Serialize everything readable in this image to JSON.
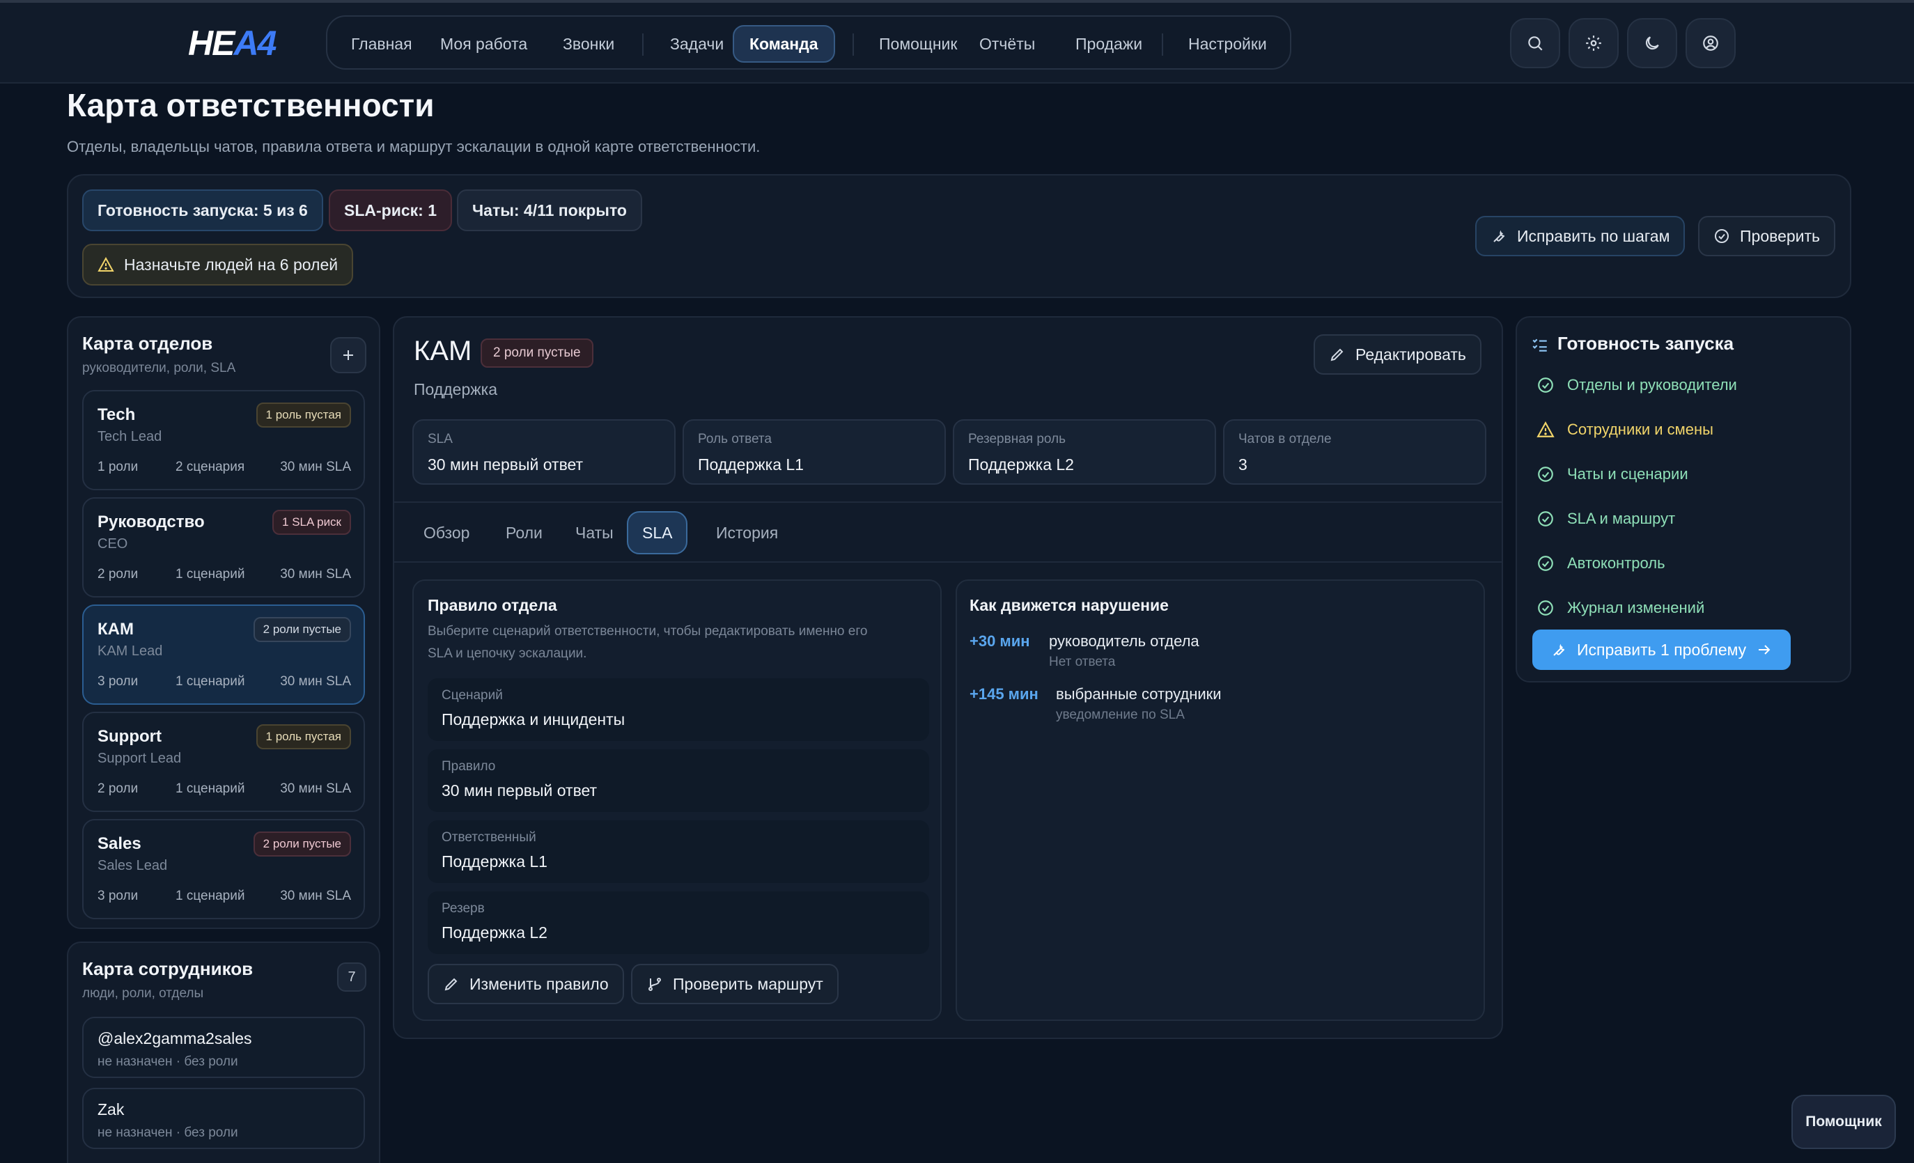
{
  "app": {
    "logo_white": "НЕ",
    "logo_blue": "А4"
  },
  "nav": {
    "items": [
      "Главная",
      "Моя работа",
      "Звонки",
      "Задачи",
      "Команда",
      "Помощник",
      "Отчёты",
      "Продажи",
      "Настройки"
    ],
    "active": "Команда"
  },
  "page": {
    "title": "Карта ответственности",
    "subtitle": "Отделы, владельцы чатов, правила ответа и маршрут эскалации в одной карте ответственности."
  },
  "status": {
    "pills": [
      "Готовность запуска: 5 из 6",
      "SLA-риск: 1",
      "Чаты: 4/11 покрыто"
    ],
    "warning": "Назначьте людей на 6 ролей",
    "fix_label": "Исправить по шагам",
    "check_label": "Проверить"
  },
  "departments": {
    "title": "Карта отделов",
    "subtitle": "руководители, роли, SLA",
    "items": [
      {
        "name": "Tech",
        "lead": "Tech Lead",
        "badge": "1 роль пустая",
        "roles": "1 роли",
        "scenarios": "2 сценария",
        "sla": "30 мин SLA"
      },
      {
        "name": "Руководство",
        "lead": "CEO",
        "badge": "1 SLA риск",
        "roles": "2 роли",
        "scenarios": "1 сценарий",
        "sla": "30 мин SLA"
      },
      {
        "name": "КАМ",
        "lead": "KAM Lead",
        "badge": "2 роли пустые",
        "roles": "3 роли",
        "scenarios": "1 сценарий",
        "sla": "30 мин SLA"
      },
      {
        "name": "Support",
        "lead": "Support Lead",
        "badge": "1 роль пустая",
        "roles": "2 роли",
        "scenarios": "1 сценарий",
        "sla": "30 мин SLA"
      },
      {
        "name": "Sales",
        "lead": "Sales Lead",
        "badge": "2 роли пустые",
        "roles": "3 роли",
        "scenarios": "1 сценарий",
        "sla": "30 мин SLA"
      }
    ]
  },
  "employees": {
    "title": "Карта сотрудников",
    "subtitle": "люди, роли, отделы",
    "count": "7",
    "items": [
      {
        "name": "@alex2gamma2sales",
        "status": "не назначен · без роли"
      },
      {
        "name": "Zak",
        "status": "не назначен · без роли"
      }
    ]
  },
  "detail": {
    "title": "КАМ",
    "badge": "2 роли пустые",
    "subtitle": "Поддержка",
    "edit_label": "Редактировать",
    "stats": [
      {
        "label": "SLA",
        "value": "30 мин первый ответ"
      },
      {
        "label": "Роль ответа",
        "value": "Поддержка L1"
      },
      {
        "label": "Резервная роль",
        "value": "Поддержка L2"
      },
      {
        "label": "Чатов в отделе",
        "value": "3"
      }
    ],
    "tabs": [
      "Обзор",
      "Роли",
      "Чаты",
      "SLA",
      "История"
    ],
    "active_tab": "SLA",
    "rule": {
      "title": "Правило отдела",
      "hint_line1": "Выберите сценарий ответственности, чтобы редактировать именно его",
      "hint_line2": "SLA и цепочку эскалации.",
      "fields": [
        {
          "label": "Сценарий",
          "value": "Поддержка и инциденты"
        },
        {
          "label": "Правило",
          "value": "30 мин первый ответ"
        },
        {
          "label": "Ответственный",
          "value": "Поддержка L1"
        },
        {
          "label": "Резерв",
          "value": "Поддержка L2"
        }
      ],
      "change_label": "Изменить правило",
      "route_label": "Проверить маршрут"
    },
    "escalation": {
      "title": "Как движется нарушение",
      "steps": [
        {
          "time": "+30 мин",
          "who": "руководитель отдела",
          "note": "Нет ответа"
        },
        {
          "time": "+145 мин",
          "who": "выбранные сотрудники",
          "note": "уведомление по SLA"
        }
      ]
    }
  },
  "readiness": {
    "title": "Готовность запуска",
    "items": [
      {
        "label": "Отделы и руководители",
        "state": "ok"
      },
      {
        "label": "Сотрудники и смены",
        "state": "warn"
      },
      {
        "label": "Чаты и сценарии",
        "state": "ok"
      },
      {
        "label": "SLA и маршрут",
        "state": "ok"
      },
      {
        "label": "Автоконтроль",
        "state": "ok"
      },
      {
        "label": "Журнал изменений",
        "state": "ok"
      }
    ],
    "fix_label": "Исправить 1 проблему"
  },
  "floating": {
    "assistant_label": "Помощник"
  },
  "colors": {
    "accent": "#3f9cf0",
    "ok": "#8fe0b8",
    "warn": "#f2d56a",
    "background": "#0b1422"
  }
}
